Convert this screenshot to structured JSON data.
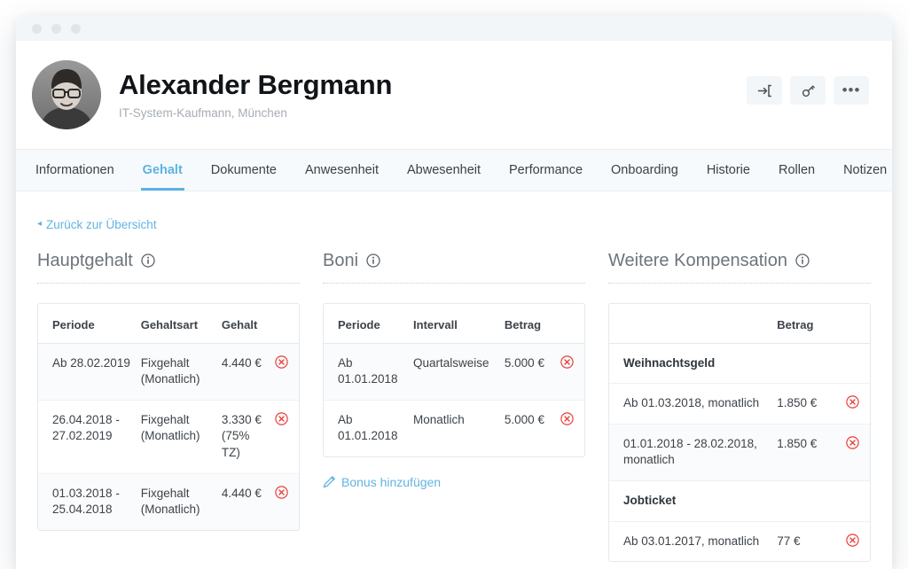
{
  "window": {
    "traffic_lights": [
      "close",
      "minimize",
      "maximize"
    ]
  },
  "header": {
    "name": "Alexander Bergmann",
    "role": "IT-System-Kaufmann, München",
    "avatar_alt": "avatar",
    "actions": [
      {
        "id": "login-as",
        "icon": "sign-in-icon",
        "label": ""
      },
      {
        "id": "password",
        "icon": "key-icon",
        "label": ""
      },
      {
        "id": "more",
        "icon": "more-icon",
        "label": "•••"
      }
    ]
  },
  "tabs": [
    {
      "label": "Informationen",
      "active": false
    },
    {
      "label": "Gehalt",
      "active": true
    },
    {
      "label": "Dokumente",
      "active": false
    },
    {
      "label": "Anwesenheit",
      "active": false
    },
    {
      "label": "Abwesenheit",
      "active": false
    },
    {
      "label": "Performance",
      "active": false
    },
    {
      "label": "Onboarding",
      "active": false
    },
    {
      "label": "Historie",
      "active": false
    },
    {
      "label": "Rollen",
      "active": false
    },
    {
      "label": "Notizen",
      "active": false
    }
  ],
  "back_link": {
    "label": "Zurück zur Übersicht",
    "icon": "triangle-left-icon"
  },
  "sections": {
    "hauptgehalt": {
      "title": "Hauptgehalt",
      "info_icon": "info-icon",
      "columns": [
        "Periode",
        "Gehaltsart",
        "Gehalt",
        ""
      ],
      "rows": [
        {
          "periode": "Ab 28.02.2019",
          "gehaltsart": "Fixgehalt (Monatlich)",
          "gehalt": "4.440 €",
          "delete_icon": "delete-circle-icon"
        },
        {
          "periode": "26.04.2018 - 27.02.2019",
          "gehaltsart": "Fixgehalt (Monatlich)",
          "gehalt": "3.330 € (75% TZ)",
          "delete_icon": "delete-circle-icon"
        },
        {
          "periode": "01.03.2018 - 25.04.2018",
          "gehaltsart": "Fixgehalt (Monatlich)",
          "gehalt": "4.440 €",
          "delete_icon": "delete-circle-icon"
        }
      ]
    },
    "boni": {
      "title": "Boni",
      "info_icon": "info-icon",
      "columns": [
        "Periode",
        "Intervall",
        "Betrag",
        ""
      ],
      "rows": [
        {
          "periode": "Ab 01.01.2018",
          "intervall": "Quartalsweise",
          "betrag": "5.000 €",
          "delete_icon": "delete-circle-icon"
        },
        {
          "periode": "Ab 01.01.2018",
          "intervall": "Monatlich",
          "betrag": "5.000 €",
          "delete_icon": "delete-circle-icon"
        }
      ],
      "add_link": {
        "label": "Bonus hinzufügen",
        "icon": "pencil-icon"
      }
    },
    "kompensation": {
      "title": "Weitere Kompensation",
      "info_icon": "info-icon",
      "columns": [
        "",
        "Betrag",
        ""
      ],
      "groups": [
        {
          "name": "Weihnachtsgeld",
          "rows": [
            {
              "periode": "Ab 01.03.2018, monatlich",
              "betrag": "1.850 €",
              "delete_icon": "delete-circle-icon"
            },
            {
              "periode": "01.01.2018 - 28.02.2018, monatlich",
              "betrag": "1.850 €",
              "delete_icon": "delete-circle-icon"
            }
          ]
        },
        {
          "name": "Jobticket",
          "rows": [
            {
              "periode": "Ab 03.01.2017, monatlich",
              "betrag": "77 €",
              "delete_icon": "delete-circle-icon"
            }
          ]
        }
      ]
    }
  },
  "colors": {
    "accent": "#5cb3e4",
    "danger": "#e8403a",
    "text": "#3d4349",
    "muted": "#a6adb4",
    "tabbar_bg": "#f7fafc"
  }
}
